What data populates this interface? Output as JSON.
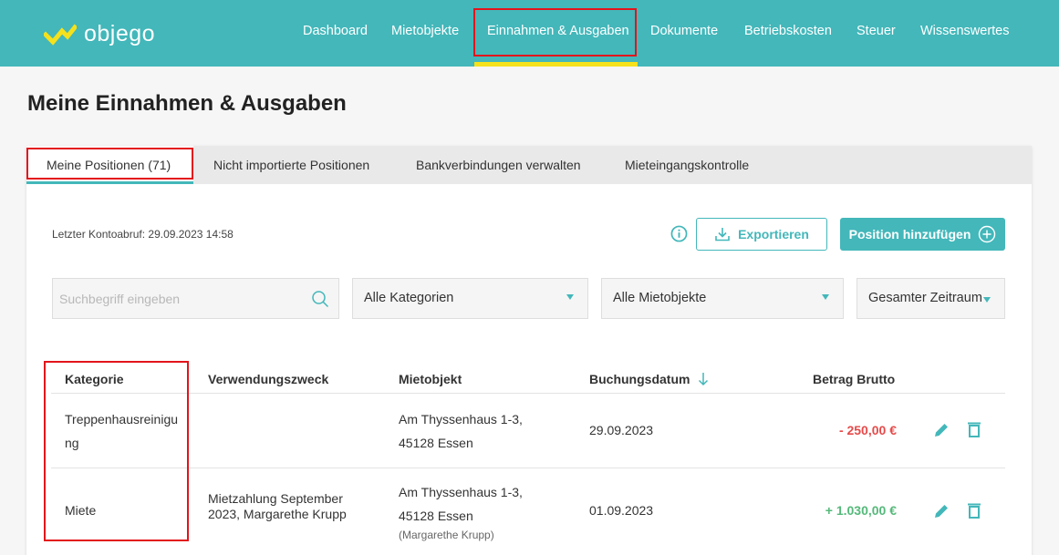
{
  "app": {
    "name": "objego"
  },
  "nav": [
    {
      "label": "Dashboard"
    },
    {
      "label": "Mietobjekte"
    },
    {
      "label": "Einnahmen & Ausgaben"
    },
    {
      "label": "Dokumente"
    },
    {
      "label": "Betriebskosten"
    },
    {
      "label": "Steuer"
    },
    {
      "label": "Wissenswertes"
    }
  ],
  "page": {
    "title": "Meine Einnahmen & Ausgaben"
  },
  "tabs": [
    {
      "label": "Meine Positionen (71)"
    },
    {
      "label": "Nicht importierte Positionen"
    },
    {
      "label": "Bankverbindungen verwalten"
    },
    {
      "label": "Mieteingangskontrolle"
    }
  ],
  "toolbar": {
    "last_fetch": "Letzter Kontoabruf: 29.09.2023 14:58",
    "export_label": "Exportieren",
    "add_label": "Position hinzufügen"
  },
  "filters": {
    "search_placeholder": "Suchbegriff eingeben",
    "category": "Alle Kategorien",
    "property": "Alle Mietobjekte",
    "period": "Gesamter Zeitraum"
  },
  "table": {
    "columns": [
      "Kategorie",
      "Verwendungszweck",
      "Mietobjekt",
      "Buchungsdatum",
      "Betrag Brutto"
    ],
    "rows": [
      {
        "category": "Treppenhausreinigung",
        "category_line1": "Treppenhausreinigu",
        "category_line2": "ng",
        "purpose_line1": "",
        "purpose_line2": "",
        "property_line1": "Am Thyssenhaus 1-3,",
        "property_line2": "45128 Essen",
        "tenant": "",
        "date": "29.09.2023",
        "amount": "- 250,00 €"
      },
      {
        "category": "Miete",
        "category_line1": "Miete",
        "category_line2": "",
        "purpose_line1": "Mietzahlung September",
        "purpose_line2": "2023, Margarethe Krupp",
        "property_line1": "Am Thyssenhaus 1-3,",
        "property_line2": "45128 Essen",
        "tenant": "(Margarethe Krupp)",
        "date": "01.09.2023",
        "amount": "+ 1.030,00 €"
      }
    ]
  },
  "colors": {
    "brand": "#43b7ba",
    "accent": "#f5e11c",
    "negative": "#e64a4a",
    "positive": "#55b97a",
    "highlight": "#e3141b"
  },
  "icons": [
    "objego-logo-icon",
    "info-icon",
    "download-icon",
    "plus-circle-icon",
    "search-icon",
    "chevron-down-icon",
    "sort-down-icon",
    "pencil-icon",
    "trash-icon"
  ]
}
